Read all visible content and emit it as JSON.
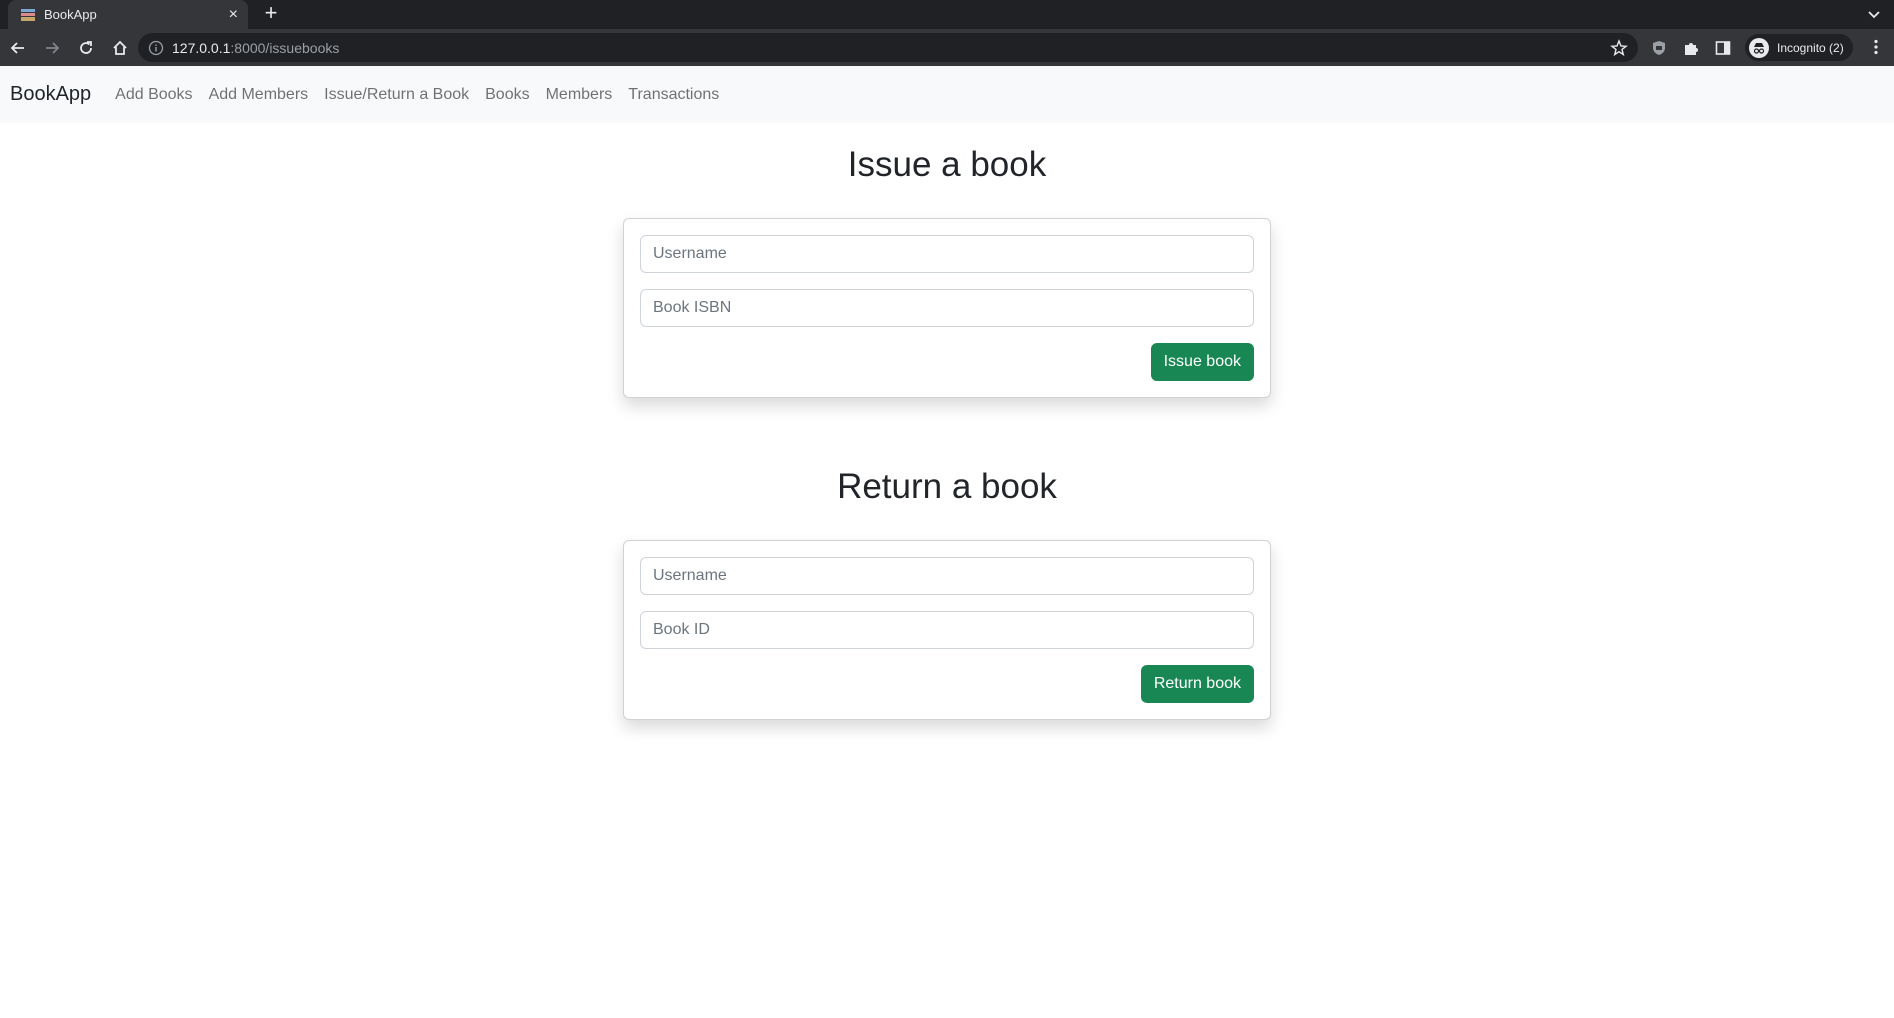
{
  "browser": {
    "tab_title": "BookApp",
    "new_tab_label": "+",
    "close_label": "×",
    "url_host": "127.0.0.1",
    "url_path": ":8000/issuebooks",
    "incognito_label": "Incognito (2)"
  },
  "navbar": {
    "brand": "BookApp",
    "links": [
      {
        "label": "Add Books"
      },
      {
        "label": "Add Members"
      },
      {
        "label": "Issue/Return a Book"
      },
      {
        "label": "Books"
      },
      {
        "label": "Members"
      },
      {
        "label": "Transactions"
      }
    ]
  },
  "issue": {
    "title": "Issue a book",
    "username_placeholder": "Username",
    "isbn_placeholder": "Book ISBN",
    "button": "Issue book"
  },
  "return": {
    "title": "Return a book",
    "username_placeholder": "Username",
    "bookid_placeholder": "Book ID",
    "button": "Return book"
  },
  "colors": {
    "success": "#198754",
    "chrome_dark": "#202124",
    "chrome_toolbar": "#35363a",
    "navbar_bg": "#f8f9fa"
  }
}
